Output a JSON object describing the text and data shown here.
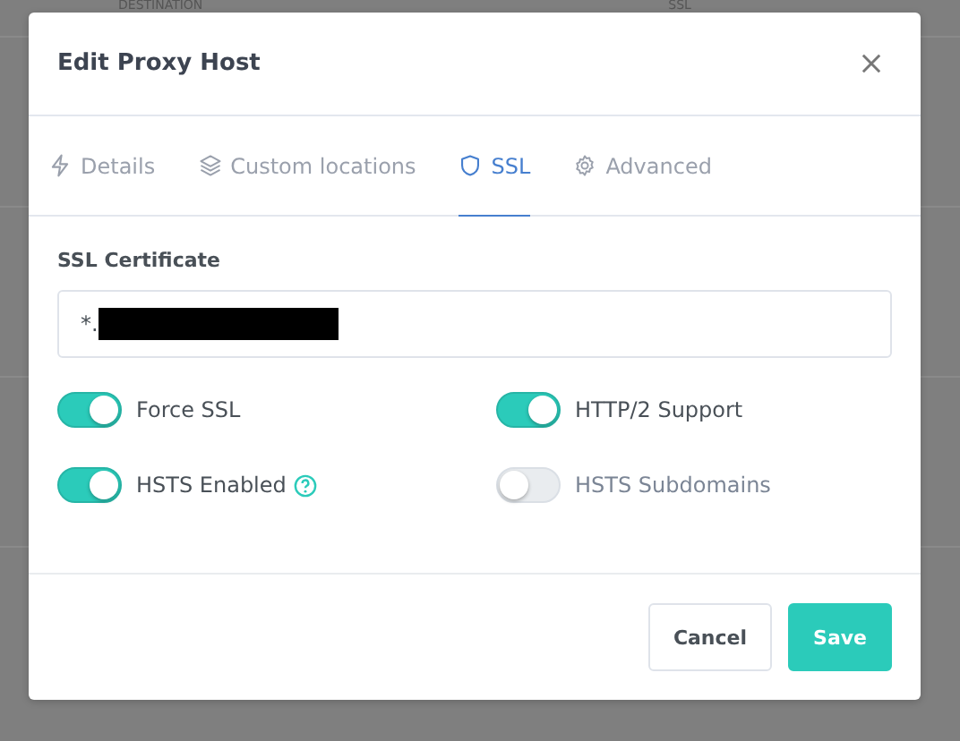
{
  "background_table": {
    "columns": [
      "DESTINATION",
      "SSL"
    ]
  },
  "modal": {
    "title": "Edit Proxy Host",
    "tabs": [
      {
        "label": "Details",
        "selected": false
      },
      {
        "label": "Custom locations",
        "selected": false
      },
      {
        "label": "SSL",
        "selected": true
      },
      {
        "label": "Advanced",
        "selected": false
      }
    ],
    "certificate": {
      "label": "SSL Certificate",
      "value": "*.",
      "redacted": true
    },
    "toggles": [
      {
        "label": "Force SSL",
        "on": true,
        "help": false
      },
      {
        "label": "HTTP/2 Support",
        "on": true,
        "help": false
      },
      {
        "label": "HSTS Enabled",
        "on": true,
        "help": true
      },
      {
        "label": "HSTS Subdomains",
        "on": false,
        "help": false
      }
    ],
    "buttons": [
      {
        "label": "Cancel",
        "kind": "secondary"
      },
      {
        "label": "Save",
        "kind": "primary"
      }
    ]
  }
}
